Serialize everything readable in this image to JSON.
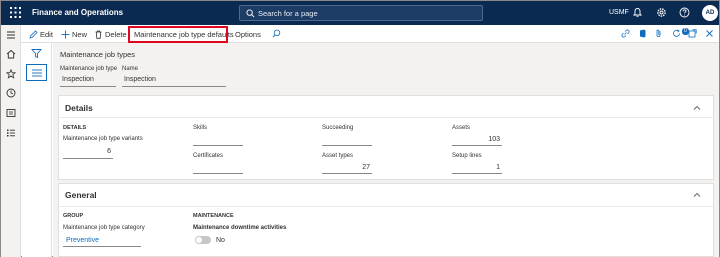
{
  "app": {
    "title": "Finance and Operations",
    "search_placeholder": "Search for a page",
    "company": "USMF",
    "avatar_initials": "AD"
  },
  "actions": {
    "edit": "Edit",
    "new": "New",
    "delete": "Delete",
    "defaults": "Maintenance job type defaults",
    "options": "Options",
    "notifications_count": "0"
  },
  "header": {
    "page_title": "Maintenance job types",
    "col1_label": "Maintenance job type",
    "col1_value": "Inspection",
    "col2_label": "Name",
    "col2_value": "Inspection"
  },
  "details": {
    "title": "Details",
    "group_label": "DETAILS",
    "variants_label": "Maintenance job type variants",
    "variants_value": "6",
    "skills_label": "Skills",
    "skills_value": "",
    "certificates_label": "Certificates",
    "certificates_value": "",
    "succeeding_label": "Succeeding",
    "succeeding_value": "",
    "asset_types_label": "Asset types",
    "asset_types_value": "27",
    "assets_label": "Assets",
    "assets_value": "103",
    "setup_lines_label": "Setup lines",
    "setup_lines_value": "1"
  },
  "general": {
    "title": "General",
    "group_label": "GROUP",
    "category_label": "Maintenance job type category",
    "category_value": "Preventive",
    "maintenance_label": "MAINTENANCE",
    "downtime_label": "Maintenance downtime activities",
    "downtime_value": "No",
    "downtime_on": false
  },
  "colors": {
    "nav_bar": "#0b2a52",
    "accent": "#0f6cbd",
    "highlight_border": "#e0061e"
  }
}
